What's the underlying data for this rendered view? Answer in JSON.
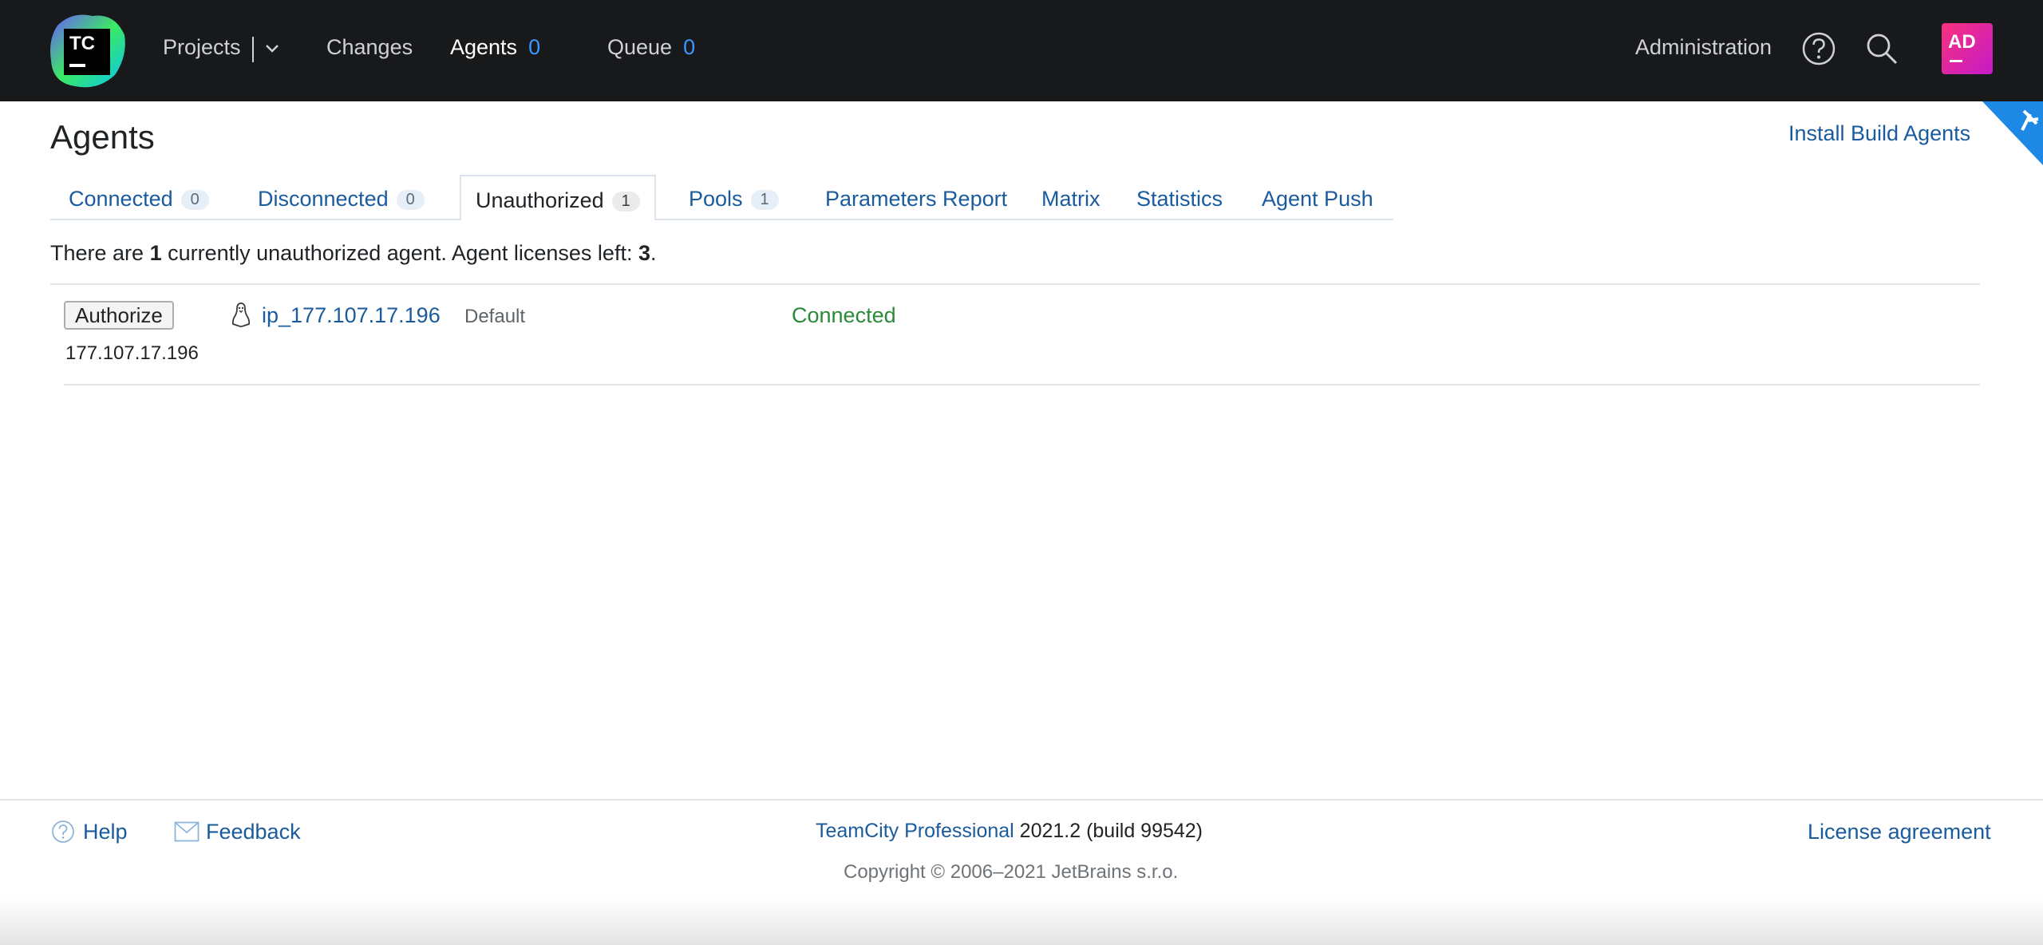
{
  "header": {
    "logo_text": "TC",
    "nav": {
      "projects": "Projects",
      "changes": "Changes",
      "agents": "Agents",
      "agents_count": "0",
      "queue": "Queue",
      "queue_count": "0"
    },
    "administration": "Administration",
    "avatar_initials": "AD",
    "icons": [
      "help-icon",
      "search-icon",
      "chevron-down-icon"
    ]
  },
  "page": {
    "title": "Agents",
    "install_link": "Install Build Agents"
  },
  "tabs": [
    {
      "label": "Connected",
      "count": "0"
    },
    {
      "label": "Disconnected",
      "count": "0"
    },
    {
      "label": "Unauthorized",
      "count": "1",
      "selected": true
    },
    {
      "label": "Pools",
      "count": "1"
    },
    {
      "label": "Parameters Report"
    },
    {
      "label": "Matrix"
    },
    {
      "label": "Statistics"
    },
    {
      "label": "Agent Push"
    }
  ],
  "summary": {
    "prefix": "There are ",
    "count": "1",
    "middle": " currently unauthorized agent. Agent licenses left: ",
    "licenses": "3",
    "suffix": "."
  },
  "agent": {
    "authorize_label": "Authorize",
    "name": "ip_177.107.17.196",
    "pool": "Default",
    "status": "Connected",
    "ip": "177.107.17.196",
    "os_icon": "linux-icon"
  },
  "footer": {
    "help": "Help",
    "feedback": "Feedback",
    "product_link": "TeamCity Professional",
    "version": " 2021.2 (build 99542)",
    "copyright": "Copyright © 2006–2021 JetBrains s.r.o.",
    "license": "License agreement"
  },
  "colors": {
    "header_bg": "#18191b",
    "link": "#1a5b9e",
    "count_accent": "#3b97ff",
    "status_connected": "#2a8a3a",
    "corner_accent": "#1e88e5",
    "avatar_gradient": [
      "#f9327d",
      "#c41ac8"
    ]
  }
}
